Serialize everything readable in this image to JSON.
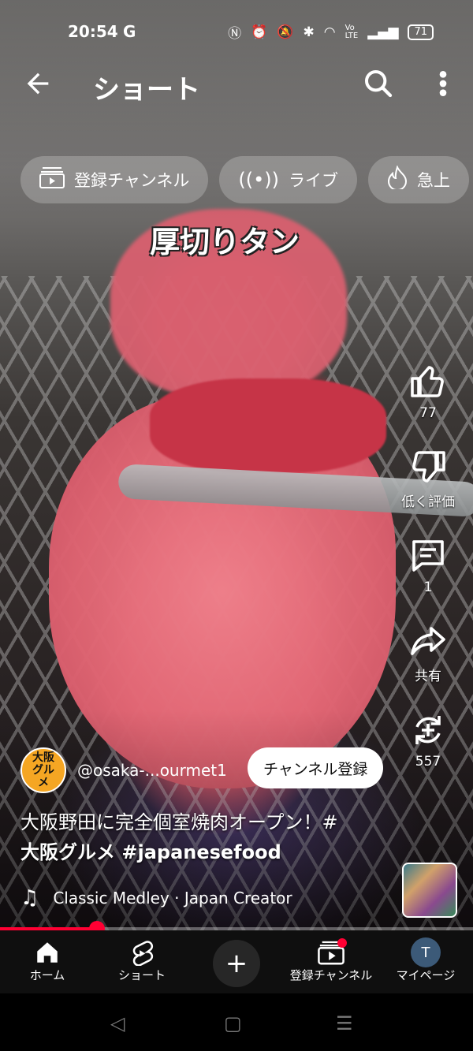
{
  "status_bar": {
    "time": "20:54",
    "carrier_icon": "G",
    "icons": [
      "nfc-icon",
      "alarm-icon",
      "mute-icon",
      "bluetooth-icon",
      "wifi-icon",
      "volte-icon",
      "signal-icon"
    ],
    "battery": "71"
  },
  "appbar": {
    "title": "ショート"
  },
  "chips": [
    {
      "label": "登録チャンネル",
      "icon": "subscriptions-icon"
    },
    {
      "label": "ライブ",
      "icon": "live-icon"
    },
    {
      "label": "急上",
      "icon": "trending-icon"
    }
  ],
  "video": {
    "overlay_text": "厚切りタン"
  },
  "actions": {
    "like_count": "77",
    "dislike_label": "低く評価",
    "comment_count": "1",
    "share_label": "共有",
    "remix_count": "557"
  },
  "channel": {
    "avatar_text": "大阪グルメ",
    "handle": "@osaka-...ourmet1",
    "subscribe_label": "チャンネル登録"
  },
  "description": {
    "line1": "大阪野田に完全個室焼肉オープン！#",
    "line2": "大阪グルメ #japanesefood"
  },
  "music": {
    "track": "Classic Medley · Japan Creator"
  },
  "progress": {
    "fraction": 0.205
  },
  "bottom_nav": {
    "home": "ホーム",
    "shorts": "ショート",
    "subscriptions": "登録チャンネル",
    "you": "マイページ",
    "you_avatar": "T"
  },
  "colors": {
    "accent": "#ff0033",
    "nav_bg": "#0f0f0f"
  }
}
